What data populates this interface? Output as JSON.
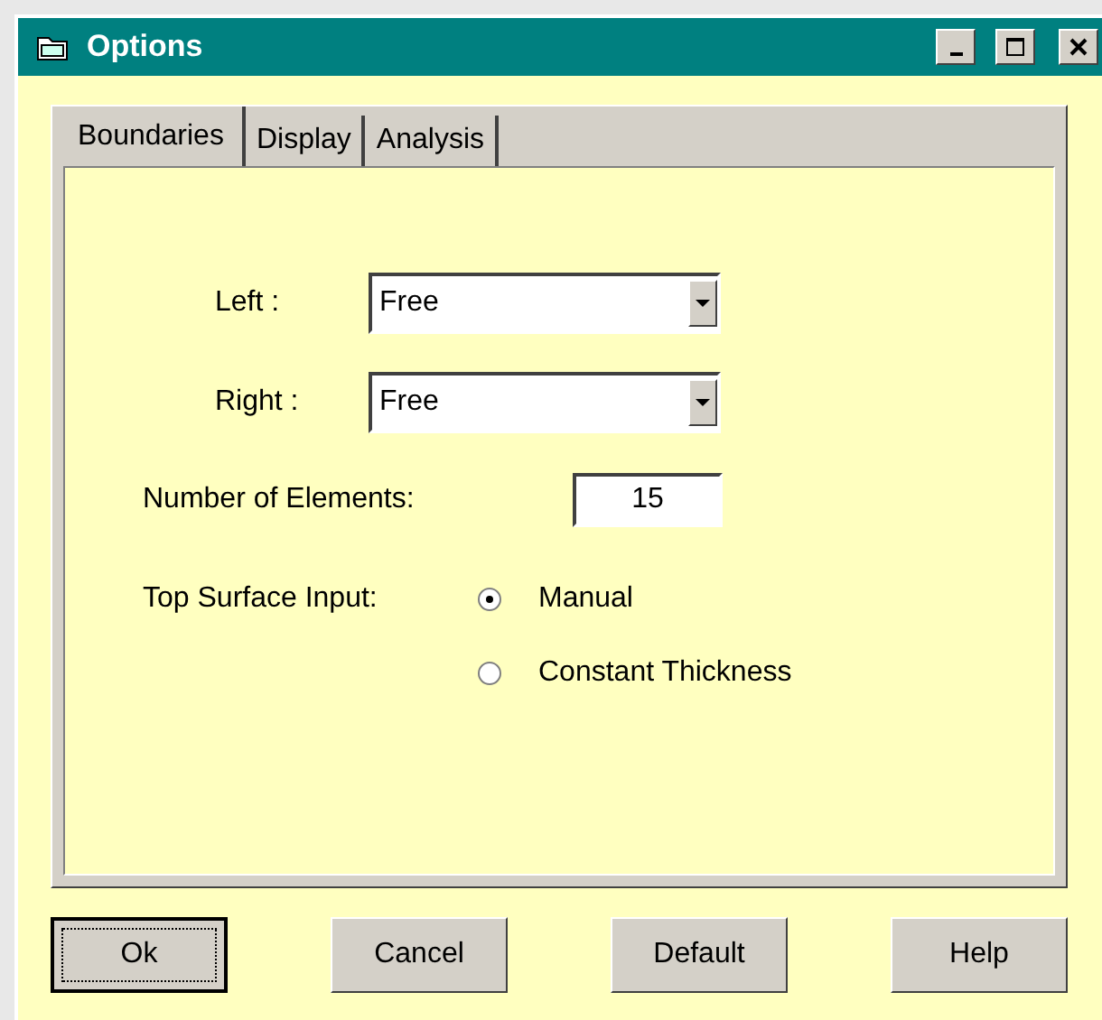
{
  "window": {
    "title": "Options"
  },
  "tabs": [
    {
      "label": "Boundaries",
      "selected": true
    },
    {
      "label": "Display",
      "selected": false
    },
    {
      "label": "Analysis",
      "selected": false
    }
  ],
  "boundaries": [
    {
      "label": "Left :",
      "value": "Free"
    },
    {
      "label": "Right :",
      "value": "Free"
    }
  ],
  "elements": {
    "label": "Number of Elements:",
    "value": "15"
  },
  "top_surface": {
    "label": "Top Surface Input:",
    "options": [
      {
        "label": "Manual",
        "selected": true
      },
      {
        "label": "Constant Thickness",
        "selected": false
      }
    ]
  },
  "buttons": [
    {
      "label": "Ok",
      "default": true
    },
    {
      "label": "Cancel",
      "default": false
    },
    {
      "label": "Default",
      "default": false
    },
    {
      "label": "Help",
      "default": false
    }
  ]
}
